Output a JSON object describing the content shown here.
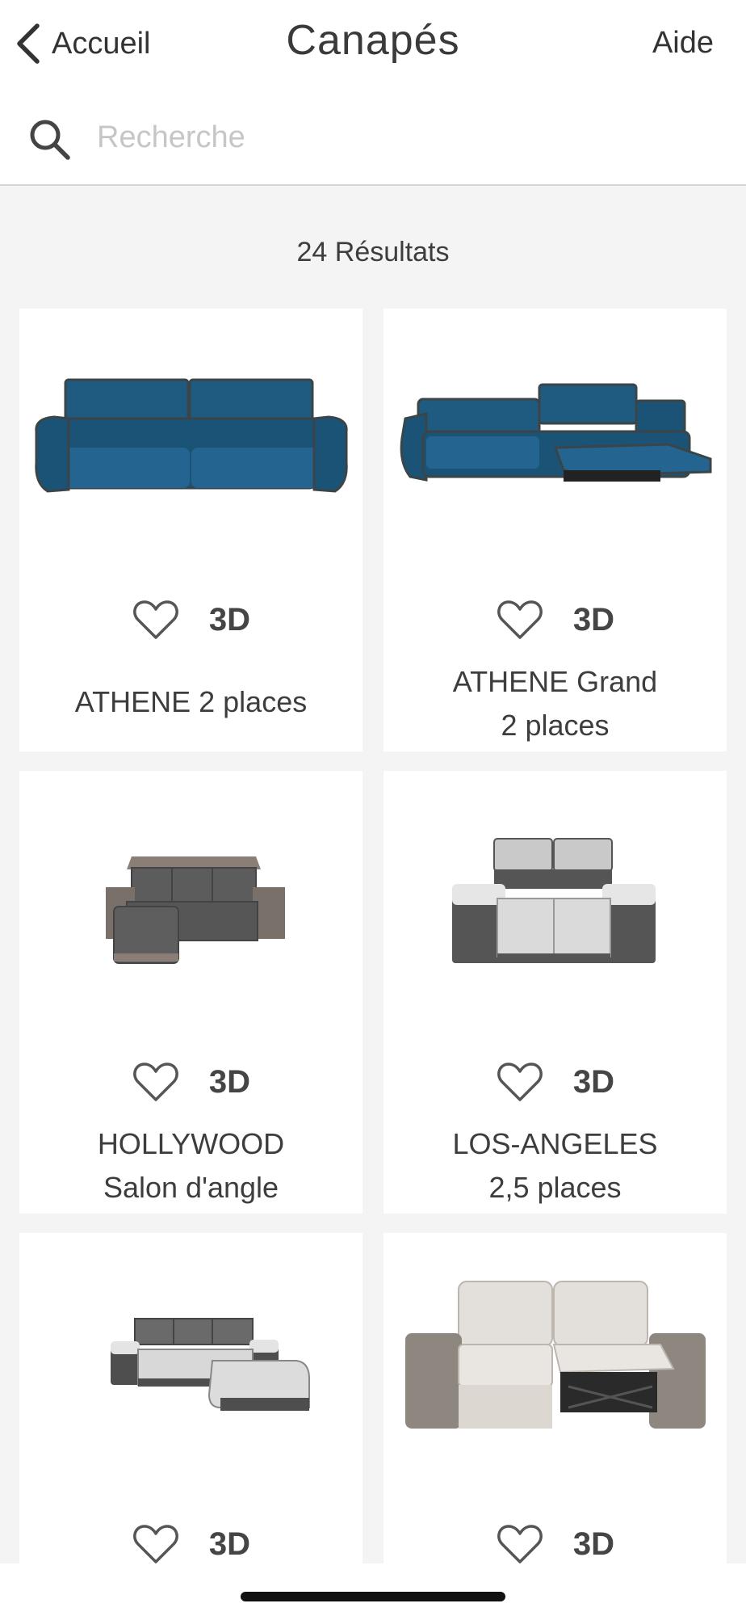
{
  "nav": {
    "back_label": "Accueil",
    "title": "Canapés",
    "help_label": "Aide"
  },
  "search": {
    "placeholder": "Recherche",
    "value": ""
  },
  "results": {
    "count_text": "24 Résultats"
  },
  "colors": {
    "background": "#f4f4f4",
    "card": "#ffffff",
    "text": "#3a3a3a",
    "placeholder": "#c6c6c6"
  },
  "products": [
    {
      "name_line1": "ATHENE 2 places",
      "name_line2": "",
      "badge": "3D",
      "favorite": false,
      "image": "blue-sofa"
    },
    {
      "name_line1": "ATHENE Grand",
      "name_line2": "2 places",
      "badge": "3D",
      "favorite": false,
      "image": "blue-recliner-sofa"
    },
    {
      "name_line1": "HOLLYWOOD",
      "name_line2": "Salon d'angle",
      "badge": "3D",
      "favorite": false,
      "image": "grey-corner-sofa"
    },
    {
      "name_line1": "LOS-ANGELES",
      "name_line2": "2,5 places",
      "badge": "3D",
      "favorite": false,
      "image": "grey-white-sofa"
    },
    {
      "name_line1": "",
      "name_line2": "",
      "badge": "3D",
      "favorite": false,
      "image": "grey-white-corner-sofa"
    },
    {
      "name_line1": "",
      "name_line2": "",
      "badge": "3D",
      "favorite": false,
      "image": "beige-recliner-sofa"
    }
  ],
  "icons": {
    "back": "chevron-left-icon",
    "search": "search-icon",
    "favorite": "heart-outline-icon"
  }
}
